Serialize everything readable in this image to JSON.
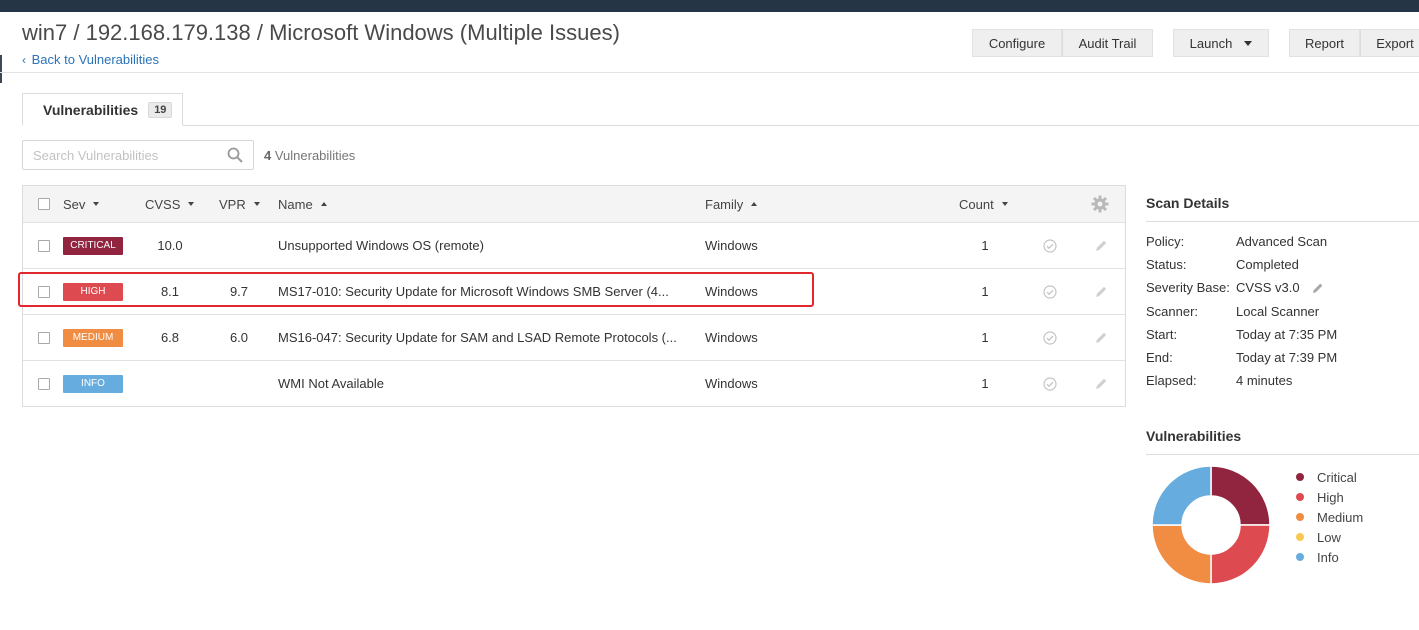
{
  "header": {
    "title": "win7 / 192.168.179.138 / Microsoft Windows (Multiple Issues)",
    "back_link": "Back to Vulnerabilities",
    "buttons": {
      "configure": "Configure",
      "audit_trail": "Audit Trail",
      "launch": "Launch",
      "report": "Report",
      "export": "Export"
    }
  },
  "tab": {
    "label": "Vulnerabilities",
    "count": "19"
  },
  "search": {
    "placeholder": "Search Vulnerabilities",
    "result_count": "4",
    "result_label": "Vulnerabilities"
  },
  "table": {
    "headers": {
      "sev": "Sev",
      "cvss": "CVSS",
      "vpr": "VPR",
      "name": "Name",
      "family": "Family",
      "count": "Count"
    },
    "rows": [
      {
        "sev": "CRITICAL",
        "sev_color": "#91243e",
        "cvss": "10.0",
        "vpr": "",
        "name": "Unsupported Windows OS (remote)",
        "family": "Windows",
        "count": "1",
        "highlighted": false
      },
      {
        "sev": "HIGH",
        "sev_color": "#dd4b50",
        "cvss": "8.1",
        "vpr": "9.7",
        "name": "MS17-010: Security Update for Microsoft Windows SMB Server (4...",
        "family": "Windows",
        "count": "1",
        "highlighted": true
      },
      {
        "sev": "MEDIUM",
        "sev_color": "#f18c43",
        "cvss": "6.8",
        "vpr": "6.0",
        "name": "MS16-047: Security Update for SAM and LSAD Remote Protocols (...",
        "family": "Windows",
        "count": "1",
        "highlighted": false
      },
      {
        "sev": "INFO",
        "sev_color": "#67acdf",
        "cvss": "",
        "vpr": "",
        "name": "WMI Not Available",
        "family": "Windows",
        "count": "1",
        "highlighted": false
      }
    ]
  },
  "scan_details": {
    "title": "Scan Details",
    "policy": {
      "label": "Policy:",
      "value": "Advanced Scan"
    },
    "status": {
      "label": "Status:",
      "value": "Completed"
    },
    "severity_base": {
      "label": "Severity Base:",
      "value": "CVSS v3.0"
    },
    "scanner": {
      "label": "Scanner:",
      "value": "Local Scanner"
    },
    "start": {
      "label": "Start:",
      "value": "Today at 7:35 PM"
    },
    "end": {
      "label": "End:",
      "value": "Today at 7:39 PM"
    },
    "elapsed": {
      "label": "Elapsed:",
      "value": "4 minutes"
    }
  },
  "chart_data": {
    "type": "pie",
    "title": "Vulnerabilities",
    "donut": true,
    "categories": [
      "Critical",
      "High",
      "Medium",
      "Low",
      "Info"
    ],
    "values": [
      1,
      1,
      1,
      0,
      1
    ],
    "colors": [
      "#91243e",
      "#dd4b50",
      "#f18c43",
      "#f8c851",
      "#67acdf"
    ],
    "legend": "right"
  },
  "colors": {
    "accent": "#2a73b8",
    "highlight_box": "#e0282e"
  }
}
